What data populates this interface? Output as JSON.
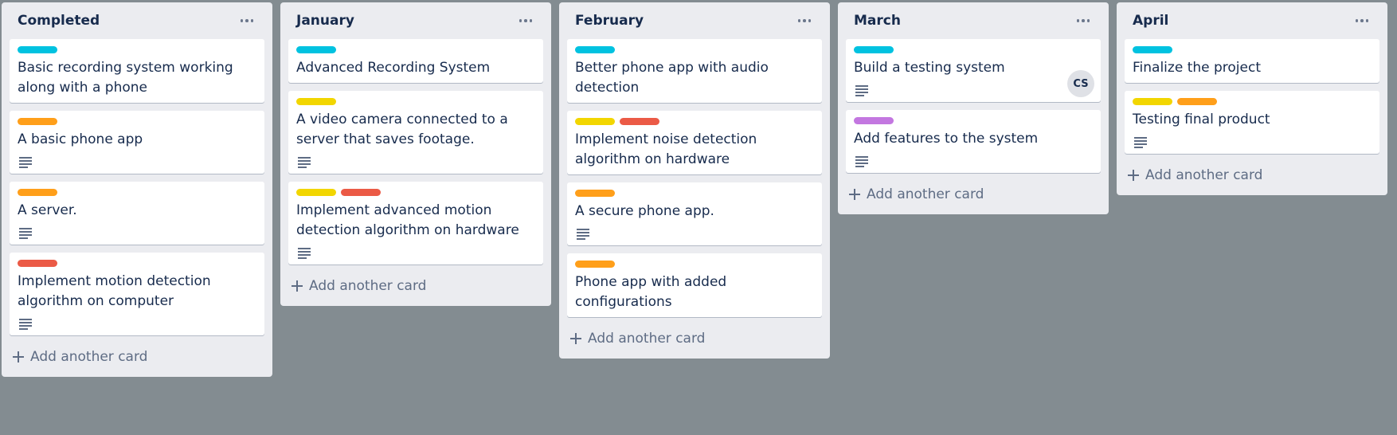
{
  "colors": {
    "board_background": "#838c91",
    "list_background": "#ebecf0",
    "label_cyan": "#00c2e0",
    "label_orange": "#ff9f1a",
    "label_yellow": "#f2d600",
    "label_red": "#eb5a46",
    "label_purple": "#c377e0"
  },
  "icons": {
    "list_menu": "ellipsis-icon",
    "description": "description-lines-icon",
    "add": "plus-icon"
  },
  "lists": [
    {
      "title": "Completed",
      "add_label": "Add another card",
      "cards": [
        {
          "title": "Basic recording system working along with a phone",
          "labels": [
            "#00c2e0"
          ],
          "has_description": false
        },
        {
          "title": "A basic phone app",
          "labels": [
            "#ff9f1a"
          ],
          "has_description": true
        },
        {
          "title": "A server.",
          "labels": [
            "#ff9f1a"
          ],
          "has_description": true
        },
        {
          "title": "Implement motion detection algorithm on computer",
          "labels": [
            "#eb5a46"
          ],
          "has_description": true
        }
      ]
    },
    {
      "title": "January",
      "add_label": "Add another card",
      "cards": [
        {
          "title": "Advanced Recording System",
          "labels": [
            "#00c2e0"
          ],
          "has_description": false
        },
        {
          "title": "A video camera connected to a server that saves footage.",
          "labels": [
            "#f2d600"
          ],
          "has_description": true
        },
        {
          "title": "Implement advanced motion detection algorithm on hardware",
          "labels": [
            "#f2d600",
            "#eb5a46"
          ],
          "has_description": true
        }
      ]
    },
    {
      "title": "February",
      "add_label": "Add another card",
      "cards": [
        {
          "title": "Better phone app with audio detection",
          "labels": [
            "#00c2e0"
          ],
          "has_description": false
        },
        {
          "title": "Implement noise detection algorithm on hardware",
          "labels": [
            "#f2d600",
            "#eb5a46"
          ],
          "has_description": false
        },
        {
          "title": "A secure phone app.",
          "labels": [
            "#ff9f1a"
          ],
          "has_description": true
        },
        {
          "title": "Phone app with added configurations",
          "labels": [
            "#ff9f1a"
          ],
          "has_description": false
        }
      ]
    },
    {
      "title": "March",
      "add_label": "Add another card",
      "cards": [
        {
          "title": "Build a testing system",
          "labels": [
            "#00c2e0"
          ],
          "has_description": true,
          "member": "CS"
        },
        {
          "title": "Add features to the system",
          "labels": [
            "#c377e0"
          ],
          "has_description": true
        }
      ]
    },
    {
      "title": "April",
      "add_label": "Add another card",
      "cards": [
        {
          "title": "Finalize the project",
          "labels": [
            "#00c2e0"
          ],
          "has_description": false
        },
        {
          "title": "Testing final product",
          "labels": [
            "#f2d600",
            "#ff9f1a"
          ],
          "has_description": true
        }
      ]
    }
  ]
}
